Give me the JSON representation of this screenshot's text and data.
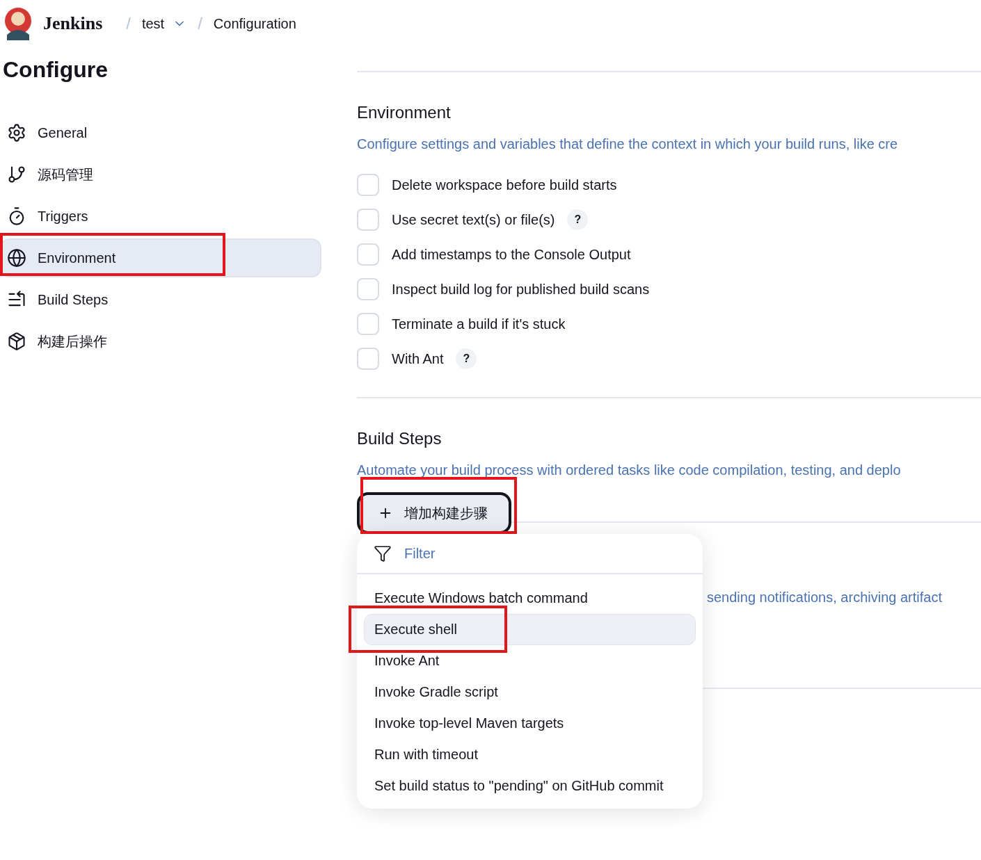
{
  "header": {
    "brand": "Jenkins",
    "breadcrumbs": [
      {
        "separator": "/",
        "label": "test",
        "dropdown": true
      },
      {
        "separator": "/",
        "label": "Configuration",
        "dropdown": false
      }
    ]
  },
  "sidebar": {
    "title": "Configure",
    "items": [
      {
        "label": "General",
        "selected": false,
        "highlighted": false
      },
      {
        "label": "源码管理",
        "selected": false,
        "highlighted": false
      },
      {
        "label": "Triggers",
        "selected": false,
        "highlighted": false
      },
      {
        "label": "Environment",
        "selected": true,
        "highlighted": true
      },
      {
        "label": "Build Steps",
        "selected": false,
        "highlighted": false
      },
      {
        "label": "构建后操作",
        "selected": false,
        "highlighted": false
      }
    ]
  },
  "environment": {
    "title": "Environment",
    "description": "Configure settings and variables that define the context in which your build runs, like cre",
    "options": [
      {
        "label": "Delete workspace before build starts",
        "checked": false
      },
      {
        "label": "Use secret text(s) or file(s)",
        "checked": false,
        "help": "?"
      },
      {
        "label": "Add timestamps to the Console Output",
        "checked": false
      },
      {
        "label": "Inspect build log for published build scans",
        "checked": false
      },
      {
        "label": "Terminate a build if it's stuck",
        "checked": false
      },
      {
        "label": "With Ant",
        "checked": false,
        "help": "?"
      }
    ]
  },
  "build_steps": {
    "title": "Build Steps",
    "description": "Automate your build process with ordered tasks like code compilation, testing, and deplo",
    "add_button": {
      "label": "增加构建步骤",
      "highlighted": true
    },
    "menu": {
      "filter_placeholder": "Filter",
      "items": [
        {
          "label": "Execute Windows batch command",
          "selected": false,
          "highlighted": false
        },
        {
          "label": "Execute shell",
          "selected": true,
          "highlighted": true
        },
        {
          "label": "Invoke Ant",
          "selected": false,
          "highlighted": false
        },
        {
          "label": "Invoke Gradle script",
          "selected": false,
          "highlighted": false
        },
        {
          "label": "Invoke top-level Maven targets",
          "selected": false,
          "highlighted": false
        },
        {
          "label": "Run with timeout",
          "selected": false,
          "highlighted": false
        },
        {
          "label": "Set build status to \"pending\" on GitHub commit",
          "selected": false,
          "highlighted": false
        }
      ]
    }
  },
  "post_build": {
    "description": "sending notifications, archiving artifact"
  }
}
